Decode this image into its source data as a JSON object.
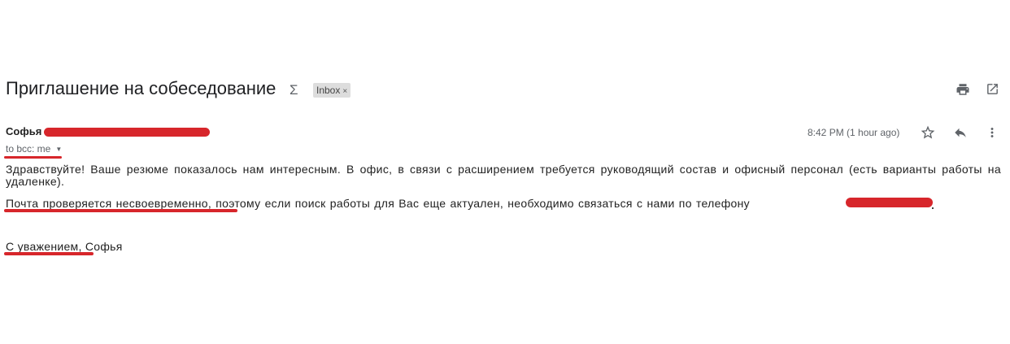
{
  "email": {
    "subject": "Приглашение на собеседование",
    "label_badge": "Inbox",
    "label_remove": "×",
    "sender_name": "Софья",
    "recipients": "to bcc: me",
    "timestamp": "8:42 PM (1 hour ago)",
    "body_p1": "Здравствуйте! Ваше резюме показалось нам интересным. В офис, в связи с расширением требуется руководящий состав и офисный персонал (есть варианты работы на удаленке).",
    "body_p2_lead": "Почта проверяется несвоевременно",
    "body_p2_rest": ", поэтому если поиск работы для Вас еще актуален, необходимо связаться с нами по телефону",
    "signature_lead": "С уважением",
    "signature_rest": ", Софья"
  },
  "colors": {
    "redaction": "#d7262b",
    "badge_bg": "#dddddd",
    "icon": "#5f6368"
  },
  "icons": [
    "important-icon",
    "print-icon",
    "open-in-new-window-icon",
    "star-icon",
    "reply-icon",
    "more-vert-icon"
  ]
}
